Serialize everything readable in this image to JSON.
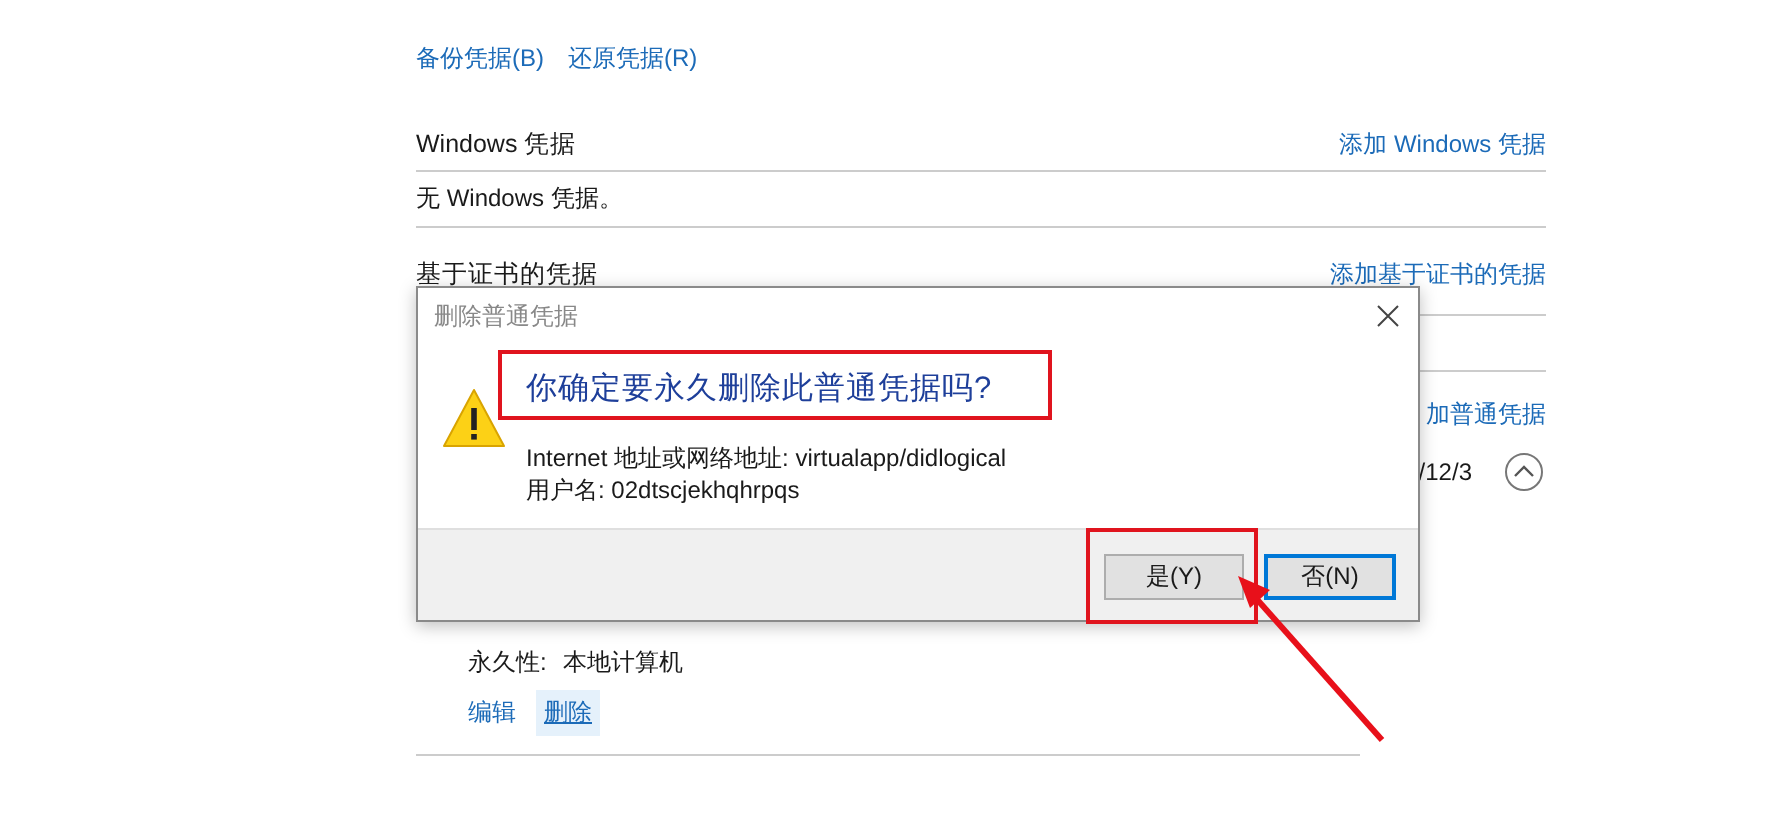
{
  "top_links": [
    "备份凭据(B)",
    "还原凭据(R)"
  ],
  "windows_credentials": {
    "title": "Windows 凭据",
    "add_link": "添加 Windows 凭据",
    "empty_text": "无 Windows 凭据。"
  },
  "certificate_credentials": {
    "title": "基于证书的凭据",
    "add_link": "添加基于证书的凭据"
  },
  "generic_credentials": {
    "add_link": "加普通凭据",
    "date": "/12/3",
    "expanded": true,
    "details": [
      {
        "label": "永久性:",
        "value": "本地计算机"
      }
    ],
    "actions": [
      {
        "label": "编辑",
        "hovered": false
      },
      {
        "label": "删除",
        "hovered": true
      }
    ]
  },
  "dialog": {
    "title": "删除普通凭据",
    "heading": "你确定要永久删除此普通凭据吗?",
    "lines": [
      "Internet 地址或网络地址: virtualapp/didlogical",
      "用户名: 02dtscjekhqhrpqs"
    ],
    "buttons": [
      {
        "label": "是(Y)",
        "focused": false
      },
      {
        "label": "否(N)",
        "focused": true
      }
    ]
  },
  "annotations": [
    {
      "kind": "box"
    },
    {
      "kind": "box"
    },
    {
      "kind": "arrow"
    }
  ]
}
